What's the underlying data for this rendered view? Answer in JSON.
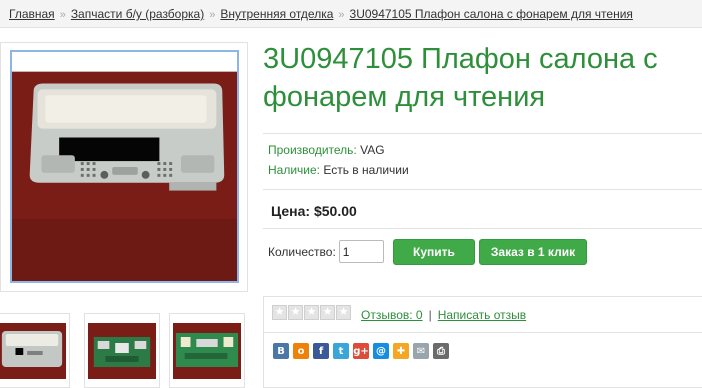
{
  "breadcrumb": {
    "home": "Главная",
    "cat1": "Запчасти б/у (разборка)",
    "cat2": "Внутренняя отделка",
    "current": "3U0947105 Плафон салона с фонарем для чтения",
    "separator": "»"
  },
  "product": {
    "title": "3U0947105 Плафон салона с фонарем для чтения",
    "manufacturer_label": "Производитель:",
    "manufacturer_value": "VAG",
    "availability_label": "Наличие:",
    "availability_value": "Есть в наличии",
    "price_label": "Цена:",
    "price_value": "$50.00",
    "quantity_label": "Количество:",
    "quantity_value": "1",
    "buy_label": "Купить",
    "one_click_label": "Заказ в 1 клик"
  },
  "reviews": {
    "rating_stars": 0,
    "rating_max": 5,
    "reviews_link": "Отзывов: 0",
    "separator": "|",
    "write_review_link": "Написать отзыв"
  },
  "share": {
    "icons": [
      "vkontakte-icon",
      "odnoklassniki-icon",
      "facebook-icon",
      "twitter-icon",
      "google-plus-icon",
      "mailru-icon",
      "liveinternet-icon",
      "email-icon",
      "print-icon"
    ],
    "glyphs": [
      "В",
      "о",
      "f",
      "t",
      "g+",
      "@",
      "✚",
      "✉",
      "⎙"
    ],
    "colors": [
      "#4a76a8",
      "#ee8208",
      "#3b5998",
      "#3aa5d8",
      "#dd4b39",
      "#168de2",
      "#f5a623",
      "#9aa4ad",
      "#6b6b6b"
    ]
  },
  "colors": {
    "accent_green": "#2e8f3a",
    "button_green": "#3faa47",
    "image_border": "#8fb4e6"
  }
}
